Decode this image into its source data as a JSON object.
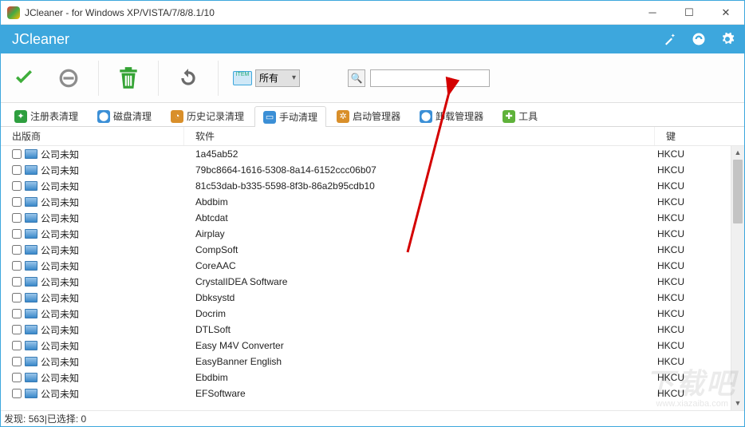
{
  "window": {
    "title": "JCleaner - for Windows XP/VISTA/7/8/8.1/10"
  },
  "brand": {
    "name": "JCleaner"
  },
  "toolbar": {
    "filter_label": "所有",
    "search_value": ""
  },
  "tabs": [
    {
      "label": "注册表清理",
      "iconColor": "#2e9f3f",
      "iconGlyph": "✦"
    },
    {
      "label": "磁盘清理",
      "iconColor": "#3b8fd6",
      "iconGlyph": "⬤"
    },
    {
      "label": "历史记录清理",
      "iconColor": "#d98f2a",
      "iconGlyph": "◔"
    },
    {
      "label": "手动清理",
      "iconColor": "#3b8fd6",
      "iconGlyph": "▭",
      "active": true
    },
    {
      "label": "启动管理器",
      "iconColor": "#d98f2a",
      "iconGlyph": "✲"
    },
    {
      "label": "卸载管理器",
      "iconColor": "#3b8fd6",
      "iconGlyph": "⬤"
    },
    {
      "label": "工具",
      "iconColor": "#5fb23a",
      "iconGlyph": "✚"
    }
  ],
  "columns": {
    "vendor": "出版商",
    "software": "软件",
    "key": "键"
  },
  "rows": [
    {
      "vendor": "公司未知",
      "software": "1a45ab52",
      "key": "HKCU"
    },
    {
      "vendor": "公司未知",
      "software": "79bc8664-1616-5308-8a14-6152ccc06b07",
      "key": "HKCU"
    },
    {
      "vendor": "公司未知",
      "software": "81c53dab-b335-5598-8f3b-86a2b95cdb10",
      "key": "HKCU"
    },
    {
      "vendor": "公司未知",
      "software": "Abdbim",
      "key": "HKCU"
    },
    {
      "vendor": "公司未知",
      "software": "Abtcdat",
      "key": "HKCU"
    },
    {
      "vendor": "公司未知",
      "software": "Airplay",
      "key": "HKCU"
    },
    {
      "vendor": "公司未知",
      "software": "CompSoft",
      "key": "HKCU"
    },
    {
      "vendor": "公司未知",
      "software": "CoreAAC",
      "key": "HKCU"
    },
    {
      "vendor": "公司未知",
      "software": "CrystalIDEA Software",
      "key": "HKCU"
    },
    {
      "vendor": "公司未知",
      "software": "Dbksystd",
      "key": "HKCU"
    },
    {
      "vendor": "公司未知",
      "software": "Docrim",
      "key": "HKCU"
    },
    {
      "vendor": "公司未知",
      "software": "DTLSoft",
      "key": "HKCU"
    },
    {
      "vendor": "公司未知",
      "software": "Easy M4V Converter",
      "key": "HKCU"
    },
    {
      "vendor": "公司未知",
      "software": "EasyBanner English",
      "key": "HKCU"
    },
    {
      "vendor": "公司未知",
      "software": "Ebdbim",
      "key": "HKCU"
    },
    {
      "vendor": "公司未知",
      "software": "EFSoftware",
      "key": "HKCU"
    }
  ],
  "status": {
    "found_label": "发现:",
    "found_count": 563,
    "sep": " | ",
    "selected_label": "已选择:",
    "selected_count": 0
  },
  "watermark": {
    "big": "下载吧",
    "small": "www.xiazaiba.com"
  }
}
